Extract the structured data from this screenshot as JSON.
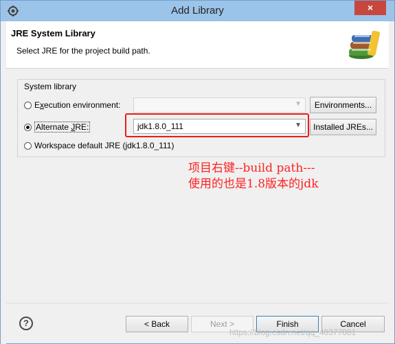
{
  "window": {
    "title": "Add Library",
    "close_label": "×"
  },
  "header": {
    "title": "JRE System Library",
    "description": "Select JRE for the project build path."
  },
  "system_library": {
    "group_label": "System library",
    "execution_env": {
      "label_pre": "E",
      "label_mnemonic": "x",
      "label_post": "ecution environment:",
      "value": "",
      "button": "Environments...",
      "checked": false
    },
    "alternate_jre": {
      "label_pre": "Alternate ",
      "label_mnemonic": "J",
      "label_post": "RE:",
      "value": "jdk1.8.0_111",
      "button": "Installed JREs...",
      "checked": true
    },
    "workspace_default": {
      "label": "Workspace default JRE (jdk1.8.0_111)",
      "checked": false
    }
  },
  "annotation": {
    "line1": "项目右键--build path---",
    "line2": "使用的也是1.8版本的jdk"
  },
  "footer": {
    "help_label": "?",
    "back": "< Back",
    "next": "Next >",
    "finish": "Finish",
    "cancel": "Cancel"
  },
  "watermark": "https://blog.csdn.net/qq_40377081",
  "colors": {
    "highlight_box": "#ef1818",
    "annotation_text": "#ff2020",
    "titlebar": "#9cc3e8"
  }
}
